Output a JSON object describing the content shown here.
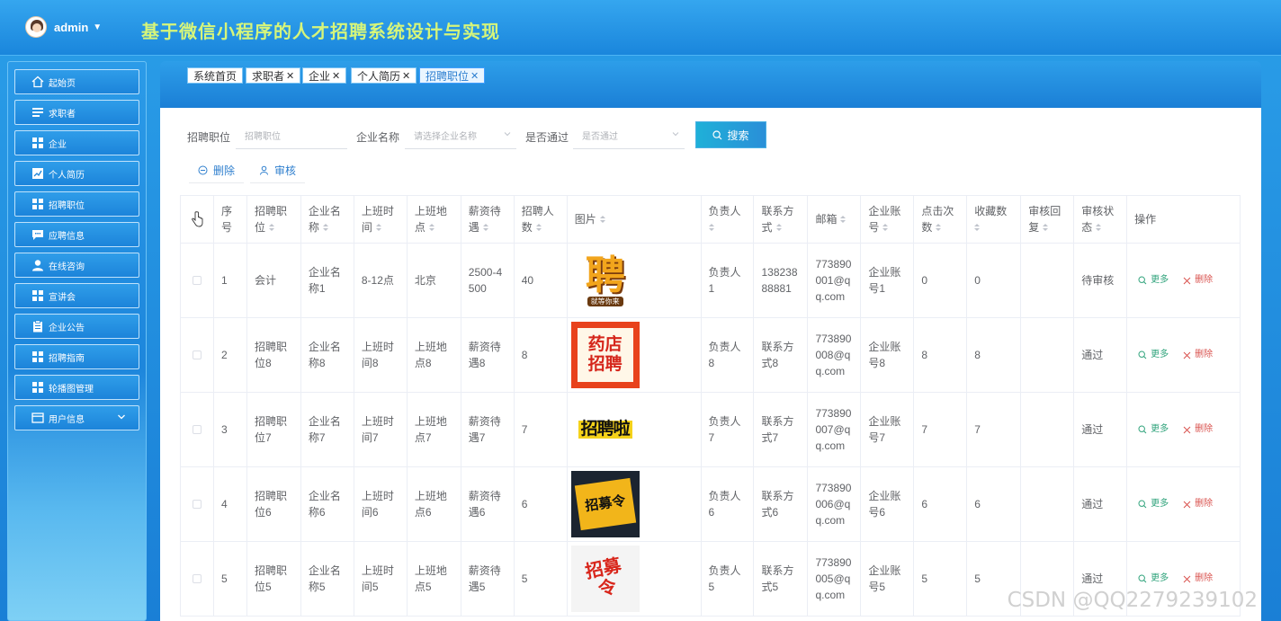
{
  "header": {
    "username": "admin",
    "title": "基于微信小程序的人才招聘系统设计与实现"
  },
  "sidebar": {
    "items": [
      {
        "label": "起始页",
        "icon": "home-icon"
      },
      {
        "label": "求职者",
        "icon": "list-icon"
      },
      {
        "label": "企业",
        "icon": "grid-icon"
      },
      {
        "label": "个人简历",
        "icon": "chart-icon"
      },
      {
        "label": "招聘职位",
        "icon": "grid-icon"
      },
      {
        "label": "应聘信息",
        "icon": "message-icon"
      },
      {
        "label": "在线咨询",
        "icon": "user-icon"
      },
      {
        "label": "宣讲会",
        "icon": "grid-icon"
      },
      {
        "label": "企业公告",
        "icon": "clipboard-icon"
      },
      {
        "label": "招聘指南",
        "icon": "grid-icon"
      },
      {
        "label": "轮播图管理",
        "icon": "grid-icon"
      },
      {
        "label": "用户信息",
        "icon": "card-icon"
      }
    ]
  },
  "tabs": [
    {
      "label": "系统首页",
      "closable": false
    },
    {
      "label": "求职者",
      "closable": true
    },
    {
      "label": "企业",
      "closable": true
    },
    {
      "label": "个人简历",
      "closable": true
    },
    {
      "label": "招聘职位",
      "closable": true
    }
  ],
  "filters": {
    "position_label": "招聘职位",
    "position_placeholder": "招聘职位",
    "company_label": "企业名称",
    "company_placeholder": "请选择企业名称",
    "approved_label": "是否通过",
    "approved_placeholder": "是否通过",
    "search_label": "搜索"
  },
  "actions": {
    "delete_label": "删除",
    "review_label": "审核"
  },
  "table": {
    "headers": [
      "序号",
      "招聘职位",
      "企业名称",
      "上班时间",
      "上班地点",
      "薪资待遇",
      "招聘人数",
      "图片",
      "负责人",
      "联系方式",
      "邮箱",
      "企业账号",
      "点击次数",
      "收藏数",
      "审核回复",
      "审核状态",
      "操作"
    ],
    "more_label": "更多",
    "delete_label": "删除",
    "rows": [
      {
        "no": "1",
        "position": "会计",
        "company": "企业名称1",
        "time": "8-12点",
        "place": "北京",
        "salary": "2500-4500",
        "count": "40",
        "pic_text": "聘",
        "pic_sub": "就等你来",
        "manager": "负责人1",
        "contact": "13823888881",
        "email": "773890001@qq.com",
        "account": "企业账号1",
        "clicks": "0",
        "favs": "0",
        "reply": "",
        "status": "待审核"
      },
      {
        "no": "2",
        "position": "招聘职位8",
        "company": "企业名称8",
        "time": "上班时间8",
        "place": "上班地点8",
        "salary": "薪资待遇8",
        "count": "8",
        "pic_text": "药店招聘",
        "pic_sub": "",
        "manager": "负责人8",
        "contact": "联系方式8",
        "email": "773890008@qq.com",
        "account": "企业账号8",
        "clicks": "8",
        "favs": "8",
        "reply": "",
        "status": "通过"
      },
      {
        "no": "3",
        "position": "招聘职位7",
        "company": "企业名称7",
        "time": "上班时间7",
        "place": "上班地点7",
        "salary": "薪资待遇7",
        "count": "7",
        "pic_text": "招聘啦",
        "pic_sub": "",
        "manager": "负责人7",
        "contact": "联系方式7",
        "email": "773890007@qq.com",
        "account": "企业账号7",
        "clicks": "7",
        "favs": "7",
        "reply": "",
        "status": "通过"
      },
      {
        "no": "4",
        "position": "招聘职位6",
        "company": "企业名称6",
        "time": "上班时间6",
        "place": "上班地点6",
        "salary": "薪资待遇6",
        "count": "6",
        "pic_text": "招募令",
        "pic_sub": "",
        "manager": "负责人6",
        "contact": "联系方式6",
        "email": "773890006@qq.com",
        "account": "企业账号6",
        "clicks": "6",
        "favs": "6",
        "reply": "",
        "status": "通过"
      },
      {
        "no": "5",
        "position": "招聘职位5",
        "company": "企业名称5",
        "time": "上班时间5",
        "place": "上班地点5",
        "salary": "薪资待遇5",
        "count": "5",
        "pic_text": "招募令",
        "pic_sub": "",
        "manager": "负责人5",
        "contact": "联系方式5",
        "email": "773890005@qq.com",
        "account": "企业账号5",
        "clicks": "5",
        "favs": "5",
        "reply": "",
        "status": "通过"
      }
    ]
  },
  "watermark": "CSDN @QQ2279239102",
  "colors": {
    "header_bg": "#1a86dc",
    "title": "#d6f57a",
    "more_link": "#2fa37b",
    "delete_link": "#d9534f"
  }
}
